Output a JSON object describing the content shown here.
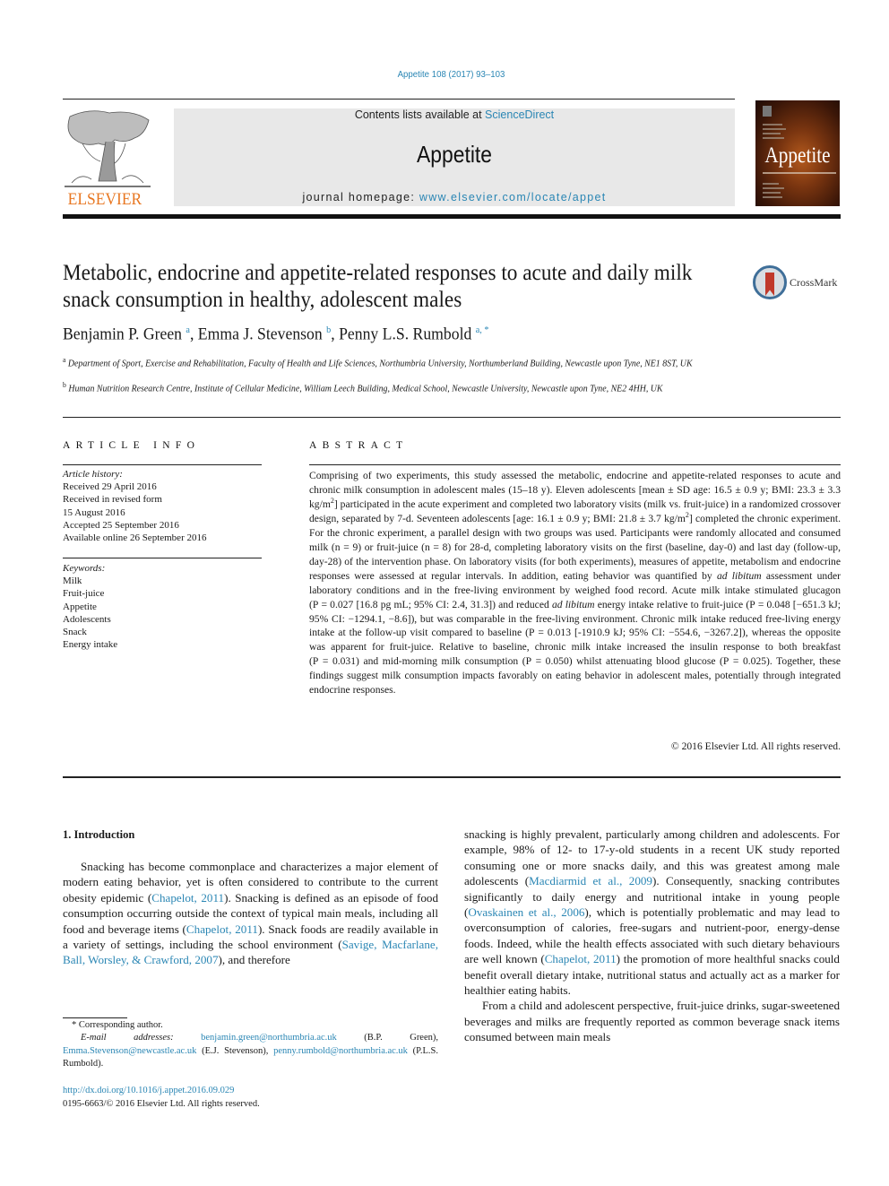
{
  "header": {
    "journal_ref": "Appetite 108 (2017) 93–103",
    "contents_prefix": "Contents lists available at ",
    "contents_link": "ScienceDirect",
    "journal_title": "Appetite",
    "homepage_prefix": "journal homepage: ",
    "homepage_link": "www.elsevier.com/locate/appet",
    "publisher_logo_text": "ELSEVIER",
    "cover_title": "Appetite",
    "brand_color": "#e87722",
    "link_color": "#2a86b4"
  },
  "article": {
    "title": "Metabolic, endocrine and appetite-related responses to acute and daily milk snack consumption in healthy, adolescent males",
    "crossmark_label": "CrossMark",
    "authors": [
      {
        "name": "Benjamin P. Green",
        "affil": "a"
      },
      {
        "name": "Emma J. Stevenson",
        "affil": "b"
      },
      {
        "name": "Penny L.S. Rumbold",
        "affil": "a, *"
      }
    ],
    "affiliations": [
      {
        "key": "a",
        "text": "Department of Sport, Exercise and Rehabilitation, Faculty of Health and Life Sciences, Northumbria University, Northumberland Building, Newcastle upon Tyne, NE1 8ST, UK"
      },
      {
        "key": "b",
        "text": "Human Nutrition Research Centre, Institute of Cellular Medicine, William Leech Building, Medical School, Newcastle University, Newcastle upon Tyne, NE2 4HH, UK"
      }
    ]
  },
  "article_info": {
    "heading": "ARTICLE INFO",
    "history_label": "Article history:",
    "history": [
      "Received 29 April 2016",
      "Received in revised form",
      "15 August 2016",
      "Accepted 25 September 2016",
      "Available online 26 September 2016"
    ],
    "keywords_label": "Keywords:",
    "keywords": [
      "Milk",
      "Fruit-juice",
      "Appetite",
      "Adolescents",
      "Snack",
      "Energy intake"
    ]
  },
  "abstract": {
    "heading": "ABSTRACT",
    "parts": {
      "p1": "Comprising of two experiments, this study assessed the metabolic, endocrine and appetite-related re­sponses to acute and chronic milk consumption in adolescent males (15–18 y). Eleven adolescents [mean ± SD age: 16.5 ± 0.9 y; BMI: 23.3 ± 3.3 kg/m",
      "sup1": "2",
      "p2": "] participated in the acute experiment and completed two laboratory visits (milk vs. fruit-juice) in a randomized crossover design, separated by 7-d. Seventeen adolescents [age: 16.1 ± 0.9 y; BMI: 21.8 ± 3.7 kg/m",
      "sup2": "2",
      "p3": "] completed the chronic experiment. For the chronic experiment, a parallel design with two groups was used. Participants were randomly allocated and consumed milk (n = 9) or fruit-juice (n = 8) for 28-d, completing laboratory visits on the first (baseline, day-0) and last day (follow-up, day-28) of the intervention phase. On laboratory visits (for both exper­iments), measures of appetite, metabolism and endocrine responses were assessed at regular intervals. In addition, eating behavior was quantified by ",
      "em1": "ad libitum",
      "p4": " assessment under laboratory conditions and in the free-living environment by weighed food record. Acute milk intake stimulated glucagon (P = 0.027 [16.8 pg mL; 95% CI: 2.4, 31.3]) and reduced ",
      "em2": "ad libitum",
      "p5": " energy intake relative to fruit-juice (P = 0.048 [−651.3 kJ; 95% CI: −1294.1, −8.6]), but was comparable in the free-living environment. Chronic milk intake reduced free-living energy intake at the follow-up visit compared to baseline (P = 0.013 [-1910.9 kJ; 95% CI: −554.6, −3267.2]), whereas the opposite was apparent for fruit-juice. Relative to baseline, chronic milk intake increased the insulin response to both breakfast (P = 0.031) and mid-morning milk consumption (P = 0.050) whilst attenuating blood glucose (P = 0.025). Together, these findings suggest milk consumption impacts favorably on eating behavior in adolescent males, potentially through integrated endocrine responses."
    },
    "copyright": "© 2016 Elsevier Ltd. All rights reserved."
  },
  "body": {
    "section_heading": "1.  Introduction",
    "left": {
      "t1": "Snacking has become commonplace and characterizes a major element of modern eating behavior, yet is often considered to contribute to the current obesity epidemic (",
      "c1": "Chapelot, 2011",
      "t2": "). Snacking is defined as an episode of food consumption occurring outside the context of typical main meals, including all food and beverage items (",
      "c2": "Chapelot, 2011",
      "t3": "). Snack foods are readily available in a variety of settings, including the school environment (",
      "c3": "Savige, Macfarlane, Ball, Worsley, & Crawford, 2007",
      "t4": "), and therefore"
    },
    "right": {
      "t1": "snacking is highly prevalent, particularly among children and ad­olescents. For example, 98% of 12- to 17-y-old students in a recent UK study reported consuming one or more snacks daily, and this was greatest among male adolescents (",
      "c1": "Macdiarmid et al., 2009",
      "t2": "). Consequently, snacking contributes significantly to daily energy and nutritional intake in young people (",
      "c2": "Ovaskainen et al., 2006",
      "t3": "), which is potentially problematic and may lead to overconsumption of calories, free-sugars and nutrient-poor, energy-dense foods. Indeed, while the health effects associated with such dietary be­haviours are well known (",
      "c3": "Chapelot, 2011",
      "t4": ") the promotion of more healthful snacks could benefit overall dietary intake, nutritional status and actually act as a marker for healthier eating habits.",
      "p2": "From a child and adolescent perspective, fruit-juice drinks, sugar-sweetened beverages and milks are frequently reported as common beverage snack items consumed between main meals"
    }
  },
  "footnotes": {
    "corresponding": "* Corresponding author.",
    "email_label": "E-mail addresses:",
    "emails": [
      {
        "address": "benjamin.green@northumbria.ac.uk",
        "owner": " (B.P. Green), "
      },
      {
        "address": "Emma.Stevenson@newcastle.ac.uk",
        "owner": " (E.J. Stevenson), "
      },
      {
        "address": "penny.rumbold@northumbria.ac.uk",
        "owner": " (P.L.S. Rumbold)."
      }
    ],
    "doi": "http://dx.doi.org/10.1016/j.appet.2016.09.029",
    "issn": "0195-6663/© 2016 Elsevier Ltd. All rights reserved."
  }
}
